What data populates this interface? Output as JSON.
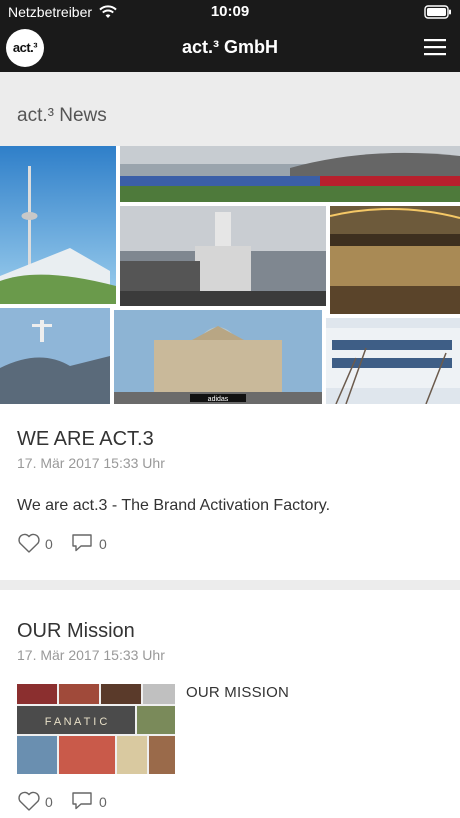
{
  "status": {
    "carrier": "Netzbetreiber",
    "time": "10:09"
  },
  "navbar": {
    "logo": "act.³",
    "title": "act.³ GmbH"
  },
  "section": {
    "title": "act.³ News"
  },
  "posts": [
    {
      "title": "WE ARE ACT.3",
      "date": "17. Mär 2017 15:33 Uhr",
      "body": "We are act.3 - The Brand Activation Factory.",
      "likes": "0",
      "comments": "0",
      "hero_banner_text": "adidas"
    },
    {
      "title": "OUR Mission",
      "date": "17. Mär 2017 15:33 Uhr",
      "thumb_text": "OUR MISSION",
      "thumb_overlay": "F A N A T I C",
      "likes": "0",
      "comments": "0"
    }
  ],
  "icons": {
    "wifi": "wifi-icon",
    "battery": "battery-icon",
    "menu": "hamburger-menu-icon",
    "like": "heart-icon",
    "comment": "comment-bubble-icon"
  }
}
